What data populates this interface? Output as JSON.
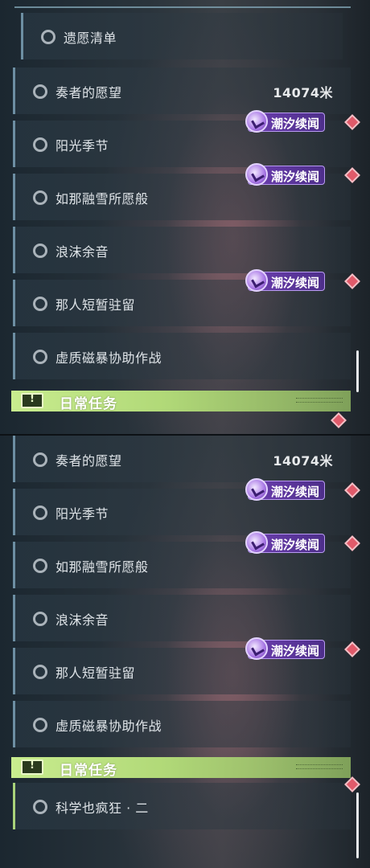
{
  "panels": [
    {
      "wish_row": {
        "label": "遗愿清单"
      },
      "tasks": [
        {
          "label": "奏者的愿望",
          "distance": "14074米",
          "badge": ""
        },
        {
          "label": "阳光季节",
          "distance": "",
          "badge": "潮汐续闻"
        },
        {
          "label": "如那融雪所愿般",
          "distance": "",
          "badge": "潮汐续闻"
        },
        {
          "label": "浪沫余音",
          "distance": "",
          "badge": ""
        },
        {
          "label": "那人短暂驻留",
          "distance": "",
          "badge": "潮汐续闻"
        },
        {
          "label": "虚质磁暴协助作战",
          "distance": "",
          "badge": ""
        }
      ],
      "section": {
        "label": "日常任务"
      }
    },
    {
      "tasks": [
        {
          "label": "奏者的愿望",
          "distance": "14074米",
          "badge": ""
        },
        {
          "label": "阳光季节",
          "distance": "",
          "badge": "潮汐续闻"
        },
        {
          "label": "如那融雪所愿般",
          "distance": "",
          "badge": "潮汐续闻"
        },
        {
          "label": "浪沫余音",
          "distance": "",
          "badge": ""
        },
        {
          "label": "那人短暂驻留",
          "distance": "",
          "badge": "潮汐续闻"
        },
        {
          "label": "虚质磁暴协助作战",
          "distance": "",
          "badge": ""
        }
      ],
      "section": {
        "label": "日常任务"
      },
      "daily_tasks": [
        {
          "label": "科学也疯狂 · 二"
        }
      ]
    }
  ],
  "colors": {
    "section_green": "#c8ec8e",
    "badge_purple": "#6d3fb0",
    "marker_red": "#e05a6a",
    "row_accent": "#6d8fa3"
  },
  "icons": [
    "circle-icon",
    "tidal-tales-logo-icon",
    "diamond-marker-icon",
    "exclamation-icon"
  ]
}
